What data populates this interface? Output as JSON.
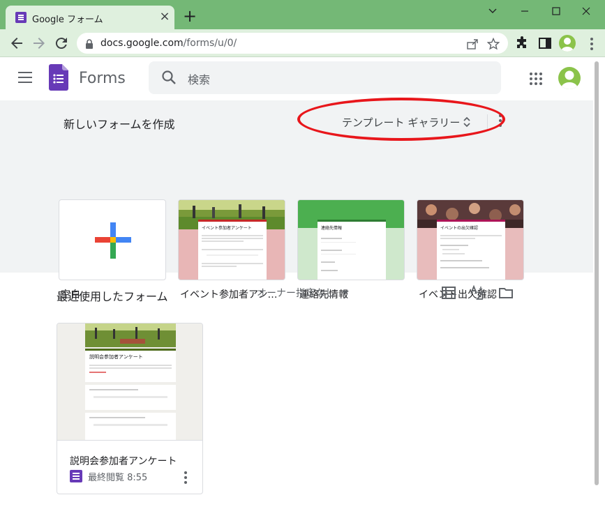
{
  "browser": {
    "tab_title": "Google フォーム",
    "tab_close": "×",
    "new_tab": "+",
    "url_host": "docs.google.com",
    "url_path": "/forms/u/0/",
    "window_controls": [
      "chevron-down-icon",
      "minimize-icon",
      "maximize-icon",
      "close-icon"
    ]
  },
  "app": {
    "name": "Forms",
    "search_placeholder": "検索",
    "accent_color": "#673ab7"
  },
  "start": {
    "title": "新しいフォームを作成",
    "gallery_label": "テンプレート ギャラリー",
    "templates": [
      {
        "name": "空白"
      },
      {
        "name": "イベント参加者アン…",
        "form_title": "イベント参加者アンケート"
      },
      {
        "name": "連絡先情報",
        "form_title": "連絡先情報"
      },
      {
        "name": "イベント出欠確認",
        "form_title": "イベントの出欠確認"
      }
    ]
  },
  "recent": {
    "title": "最近使用したフォーム",
    "owner_filter": "オーナー指定なし",
    "documents": [
      {
        "title": "説明会参加者アンケート",
        "opened": "最終閲覧 8:55",
        "preview_title": "説明会参加者アンケート"
      }
    ]
  },
  "annotation": {
    "color": "#e8161b"
  }
}
